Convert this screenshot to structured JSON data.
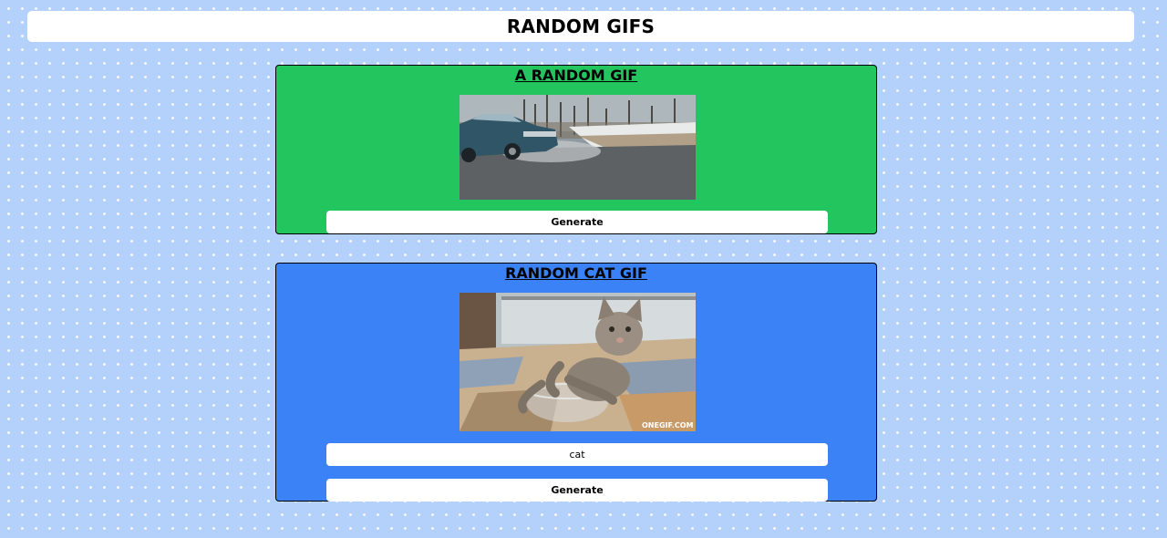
{
  "header": {
    "title": "RANDOM GIFS"
  },
  "random_card": {
    "title": "A RANDOM GIF",
    "button_label": "Generate",
    "color": "#22c55e"
  },
  "cat_card": {
    "title": "RANDOM CAT GIF",
    "input_value": "cat",
    "button_label": "Generate",
    "gif_watermark": "ONEGIF.COM",
    "color": "#3b82f6"
  },
  "colors": {
    "background": "#b3d1fb",
    "surface": "#ffffff"
  }
}
